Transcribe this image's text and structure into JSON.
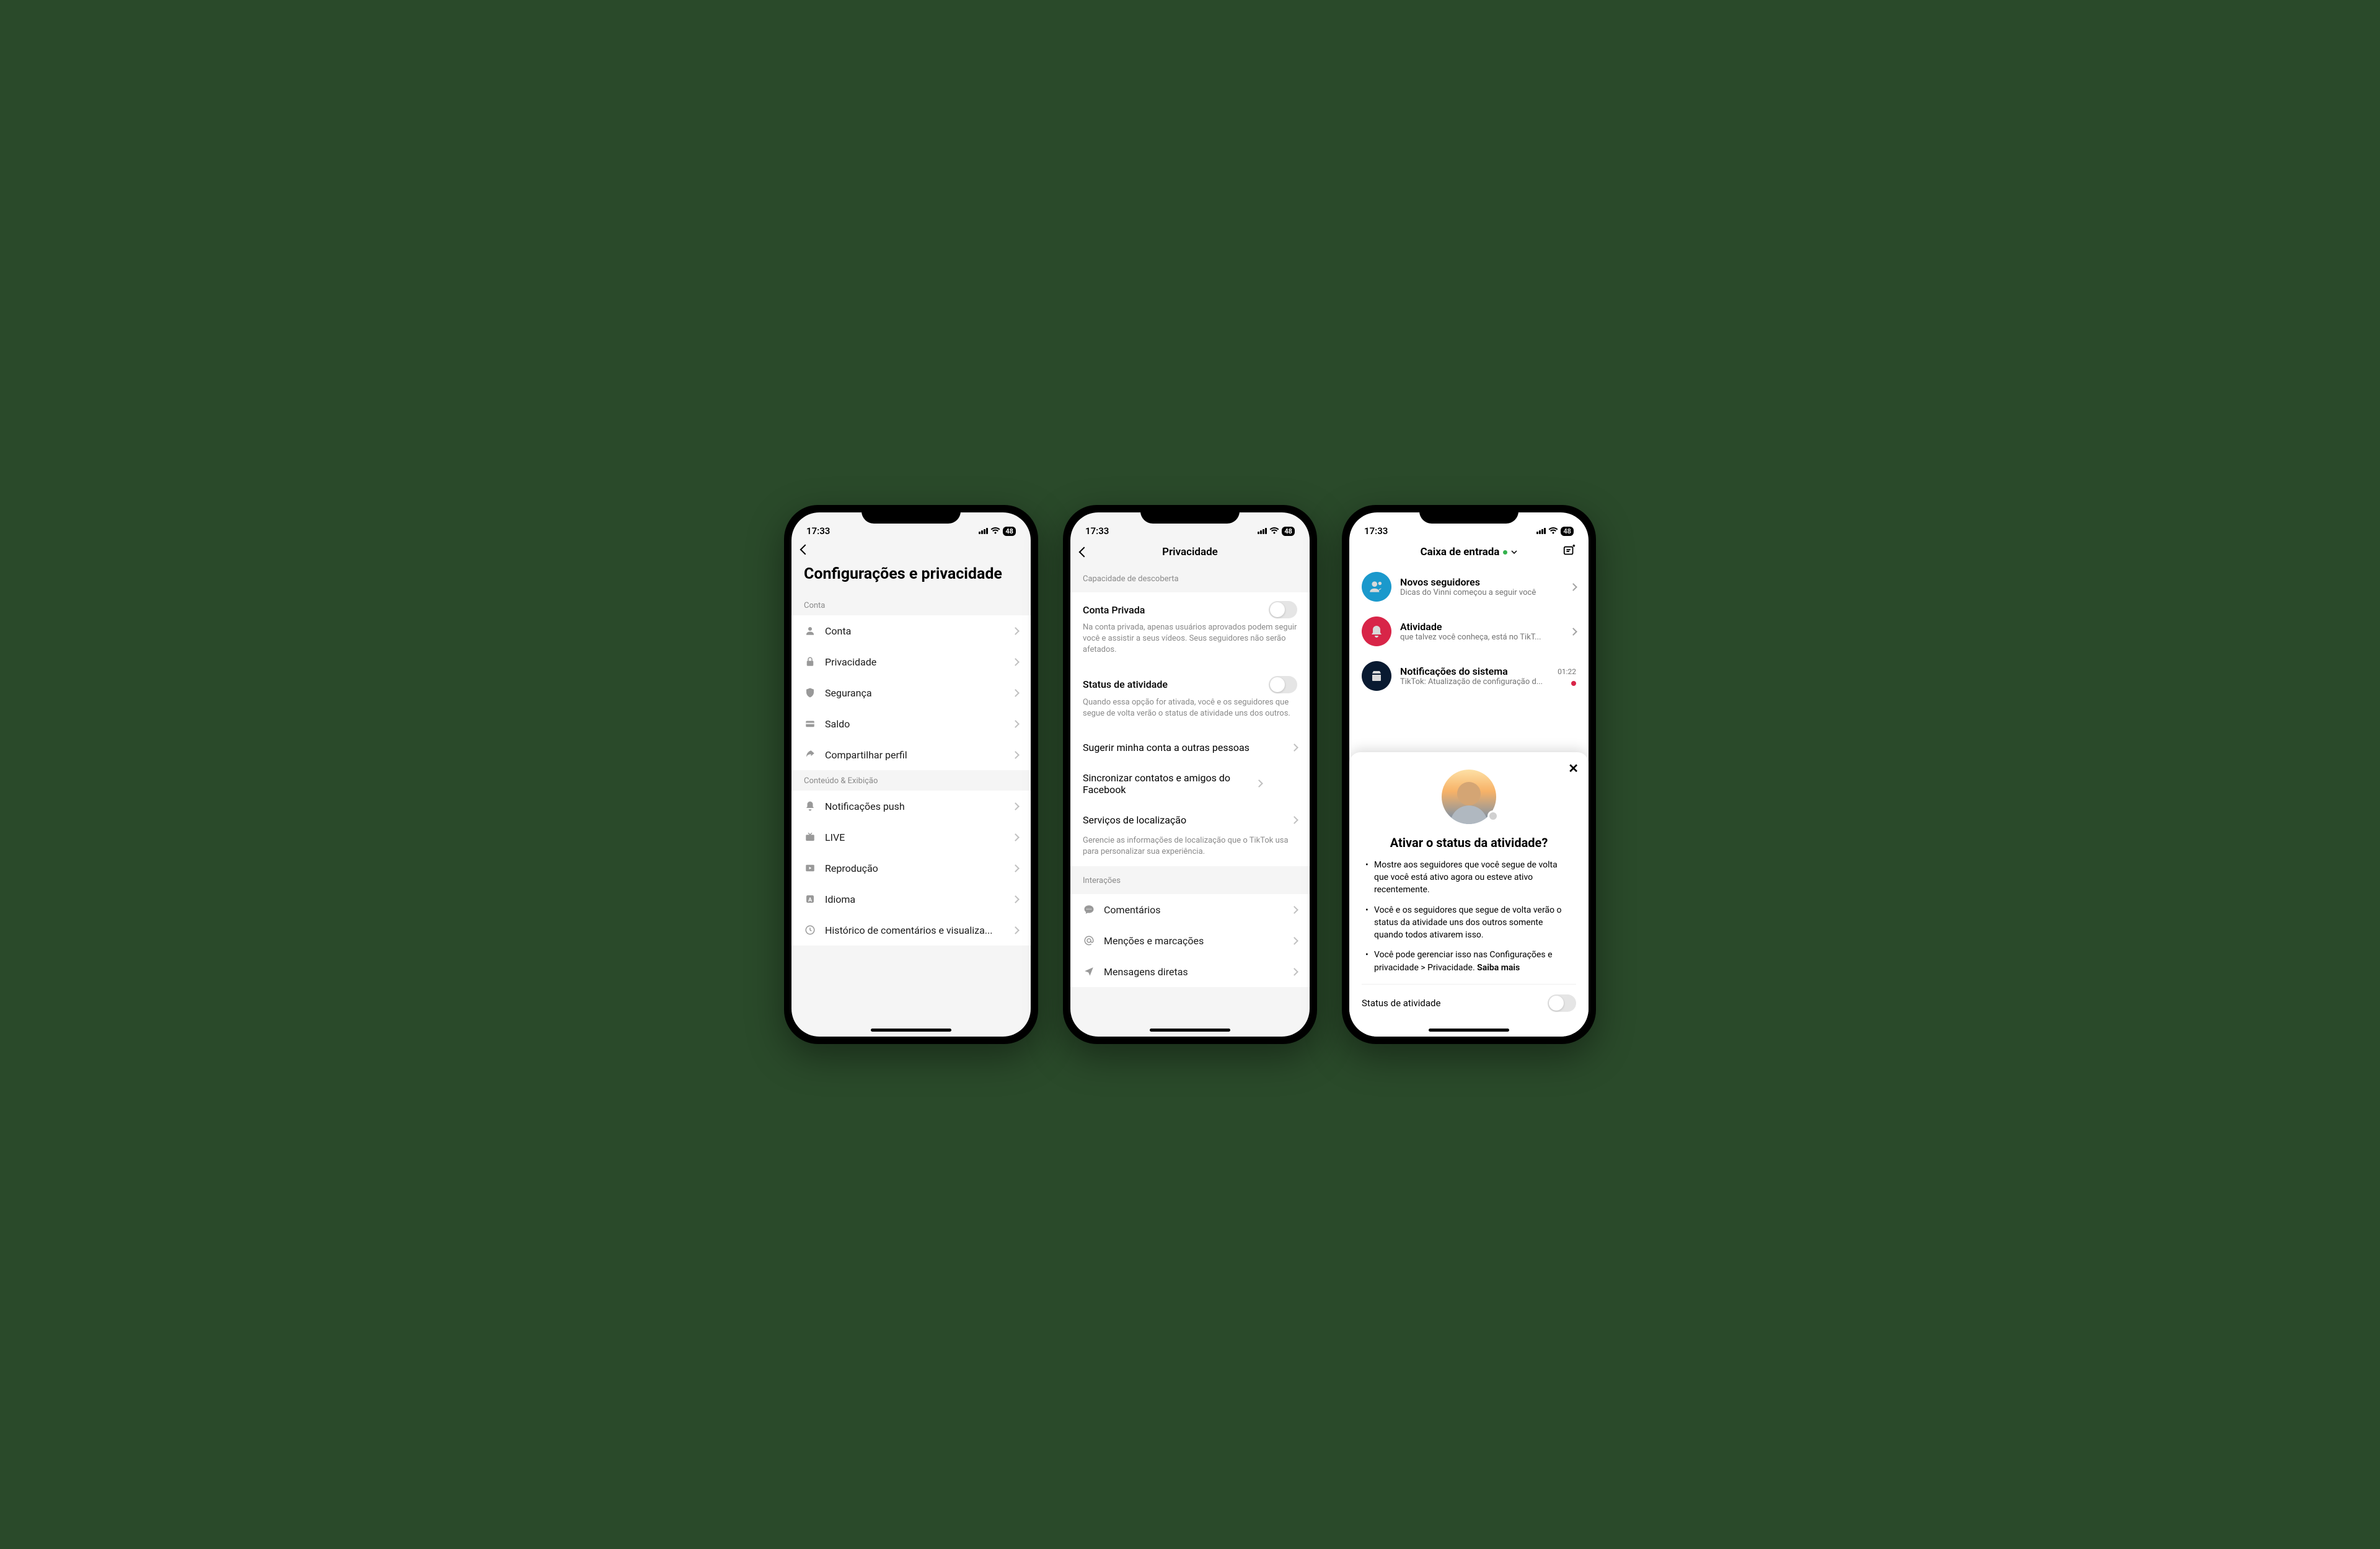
{
  "status": {
    "time": "17:33",
    "battery": "48"
  },
  "screen1": {
    "title": "Configurações e privacidade",
    "section1": "Conta",
    "items1": [
      {
        "label": "Conta"
      },
      {
        "label": "Privacidade"
      },
      {
        "label": "Segurança"
      },
      {
        "label": "Saldo"
      },
      {
        "label": "Compartilhar perfil"
      }
    ],
    "section2": "Conteúdo & Exibição",
    "items2": [
      {
        "label": "Notificações push"
      },
      {
        "label": "LIVE"
      },
      {
        "label": "Reprodução"
      },
      {
        "label": "Idioma"
      },
      {
        "label": "Histórico de comentários e visualiza..."
      }
    ]
  },
  "screen2": {
    "title": "Privacidade",
    "section1": "Capacidade de descoberta",
    "privateAccount": {
      "title": "Conta Privada",
      "desc": "Na conta privada, apenas usuários aprovados podem seguir você e assistir a seus vídeos. Seus seguidores não serão afetados."
    },
    "activityStatus": {
      "title": "Status de atividade",
      "desc": "Quando essa opção for ativada, você e os seguidores que segue de volta verão o status de atividade uns dos outros."
    },
    "suggest": "Sugerir minha conta a outras pessoas",
    "sync": "Sincronizar contatos e amigos do Facebook",
    "location": "Serviços de localização",
    "locationDesc": "Gerencie as informações de localização que o TikTok usa para personalizar sua experiência.",
    "section2": "Interações",
    "comments": "Comentários",
    "mentions": "Menções e marcações",
    "dm": "Mensagens diretas"
  },
  "screen3": {
    "title": "Caixa de entrada",
    "items": [
      {
        "title": "Novos seguidores",
        "sub": "Dicas do Vinni começou a seguir você",
        "color": "#20b4f0"
      },
      {
        "title": "Atividade",
        "sub": "que talvez você conheça, está no TikT...",
        "color": "#fe2c55"
      },
      {
        "title": "Notificações do sistema",
        "sub": "TikTok: Atualização de configuração d...",
        "color": "#0b1f3a",
        "time": "01:22",
        "dot": true
      }
    ],
    "sheet": {
      "title": "Ativar o status da atividade?",
      "bullets": [
        "Mostre aos seguidores que você segue de volta que você está ativo agora ou esteve ativo recentemente.",
        "Você e os seguidores que segue de volta verão o status da atividade uns dos outros somente quando todos ativarem isso.",
        "Você pode gerenciar isso nas Configurações e privacidade > Privacidade."
      ],
      "learnMore": "Saiba mais",
      "toggleLabel": "Status de atividade"
    }
  }
}
